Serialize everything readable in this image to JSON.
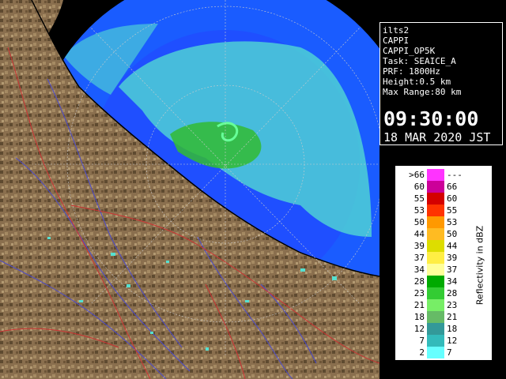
{
  "info": {
    "lines": [
      "ilts2",
      "CAPPI",
      "CAPPI_OP5K",
      "Task: SEAICE_A",
      "PRF: 1800Hz",
      "Height:0.5 km",
      "Max Range:80 km"
    ],
    "time": "09:30:00",
    "date": "18 MAR 2020 JST"
  },
  "legend": {
    "unit": "Reflectivity in dBZ",
    "rows": [
      {
        "lo": ">66",
        "hi": "---",
        "color": "#ff33ff"
      },
      {
        "lo": "60",
        "hi": "66",
        "color": "#cc0099"
      },
      {
        "lo": "55",
        "hi": "60",
        "color": "#d40000"
      },
      {
        "lo": "53",
        "hi": "55",
        "color": "#ff3300"
      },
      {
        "lo": "50",
        "hi": "53",
        "color": "#ff9900"
      },
      {
        "lo": "44",
        "hi": "50",
        "color": "#ffbb22"
      },
      {
        "lo": "39",
        "hi": "44",
        "color": "#dddd00"
      },
      {
        "lo": "37",
        "hi": "39",
        "color": "#ffee44"
      },
      {
        "lo": "34",
        "hi": "37",
        "color": "#ffff99"
      },
      {
        "lo": "28",
        "hi": "34",
        "color": "#00aa00"
      },
      {
        "lo": "23",
        "hi": "28",
        "color": "#33cc33"
      },
      {
        "lo": "21",
        "hi": "23",
        "color": "#77ee66"
      },
      {
        "lo": "18",
        "hi": "21",
        "color": "#66bb66"
      },
      {
        "lo": "12",
        "hi": "18",
        "color": "#339999"
      },
      {
        "lo": "7",
        "hi": "12",
        "color": "#33bbbb"
      },
      {
        "lo": "2",
        "hi": "7",
        "color": "#66ffff"
      }
    ]
  },
  "map": {
    "colors": {
      "background": "#000000",
      "land": "#8a6f4e",
      "land_dark": "#5e4a30",
      "sea_range": "#1a5cff",
      "sea_inner": "#1f4fff",
      "rivers": "#4a4acc",
      "boundaries": "#cc3333",
      "range_ring": "#cccccc",
      "echo_light": "#55e0d0",
      "echo_green": "#33bb33"
    }
  }
}
